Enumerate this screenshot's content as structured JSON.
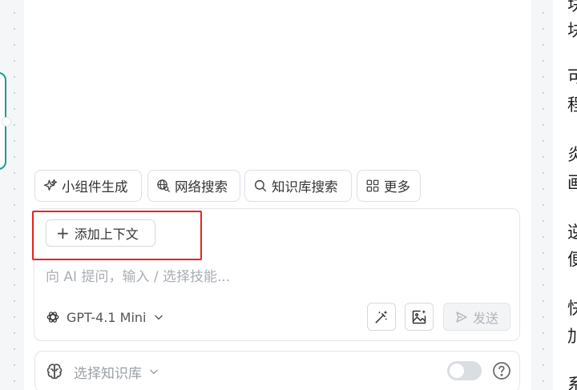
{
  "right_panel": {
    "chars": [
      "块",
      "可",
      "程",
      "炎",
      "画",
      "逆",
      "便",
      "快",
      "加",
      "系"
    ]
  },
  "chips": [
    {
      "label": "小组件生成",
      "icon": "sparkle-icon"
    },
    {
      "label": "网络搜索",
      "icon": "globe-search-icon"
    },
    {
      "label": "知识库搜索",
      "icon": "search-icon"
    },
    {
      "label": "更多",
      "icon": "grid-icon"
    }
  ],
  "composer": {
    "add_context_label": "添加上下文",
    "placeholder": "向 AI 提问，输入 / 选择技能...",
    "value": "",
    "model_label": "GPT-4.1 Mini",
    "send_label": "发送"
  },
  "knowledge_base": {
    "placeholder_label": "选择知识库",
    "toggle_on": false
  },
  "colors": {
    "accent_teal": "#1f9c93",
    "highlight_red": "#e8241f",
    "border": "#dcdfe5",
    "placeholder": "#a9adb3"
  }
}
